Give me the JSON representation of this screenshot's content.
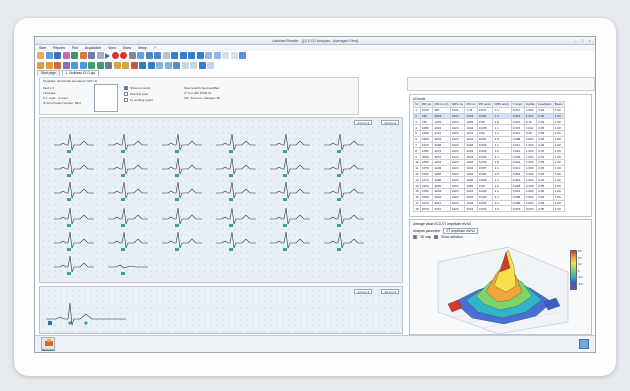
{
  "window": {
    "title": "Labchart Reader - [(1) ECG Analysis - Averaged View]"
  },
  "menu": {
    "items": [
      "Start",
      "Reports",
      "Plot",
      "Acquisition",
      "View",
      "Show",
      "Setup",
      "?"
    ]
  },
  "tabs": [
    {
      "label": "Start page"
    },
    {
      "label": "1. Multilead ECG.tgd"
    }
  ],
  "config": {
    "template": "Template: Ventricular premature (VPC 4)",
    "rows": [
      [
        "Mod",
        "1",
        "2"
      ],
      [
        "I",
        "Average"
      ],
      [
        "II",
        "1: Light · Correct"
      ],
      [
        "III",
        "Short beats Number: 89/4"
      ]
    ],
    "checks": [
      {
        "label": "Show on report",
        "checked": true
      },
      {
        "label": "Pick this beat",
        "checked": false
      },
      {
        "label": "To working report",
        "checked": false
      }
    ],
    "note": [
      "Source ECG Sources/Mac",
      "A* 2 to 24h 15/03 Int",
      "Info: Zoom 2+ changed, Alt"
    ]
  },
  "top_panel": {
    "left_menu": "24 min",
    "right_menu": "24 mm",
    "scale_left": "24 mm ▾",
    "scale_right": "24 mm ▾"
  },
  "bottom_panel": {
    "label": "24 mm ▾",
    "label2": "24 mm ▾"
  },
  "table": {
    "title": "All beats",
    "headers": [
      "Nr",
      "RR ms",
      "RR ms (A)",
      "QRS ms",
      "PR ms",
      "PR ampl.",
      "QRS ampl.",
      "T ampl.",
      "Cardio",
      "Feedback",
      "Beats"
    ],
    "rows": [
      [
        "1",
        "1070",
        "387",
        "1221",
        "1.44",
        "0.011",
        "1.1",
        "0.017",
        "1.001",
        "0.04",
        "1.00"
      ],
      [
        "2",
        "750",
        "3018",
        "1024",
        "1044",
        "0.004",
        "1.1",
        "0.014",
        "1.011",
        "0.06",
        "1.00"
      ],
      [
        "3",
        "760",
        "1270",
        "1024",
        "1033",
        "0.00",
        "1.0",
        "0.014",
        "0.10",
        "0.04",
        "1.00"
      ],
      [
        "4",
        "1080",
        "3201",
        "1024",
        "1044",
        "0.005",
        "1.1",
        "0.015",
        "1.011",
        "0.05",
        "1.00"
      ],
      [
        "5",
        "2190",
        "2211",
        "1024",
        "1031",
        "0.00",
        "1.1",
        "0.011",
        "0.10",
        "0.05",
        "1.00"
      ],
      [
        "6",
        "3100",
        "3201",
        "1024",
        "1044",
        "0.001",
        "1.0",
        "0.008",
        "1.004",
        "0.05",
        "1.00"
      ],
      [
        "7",
        "1070",
        "3200",
        "1024",
        "1022",
        "0.009",
        "1.1",
        "0.011",
        "1.004",
        "0.05",
        "1.00"
      ],
      [
        "8",
        "1080",
        "3212",
        "1024",
        "1041",
        "0.002",
        "1.0",
        "0.010",
        "1.000",
        "0.04",
        "1.00"
      ],
      [
        "9",
        "3060",
        "3270",
        "1024",
        "1043",
        "0.004",
        "1.1",
        "0.009",
        "1.002",
        "0.04",
        "1.00"
      ],
      [
        "10",
        "1060",
        "3210",
        "1024",
        "1034",
        "0.009",
        "1.0",
        "0.012",
        "1.003",
        "0.05",
        "1.00"
      ],
      [
        "11",
        "1070",
        "3220",
        "1024",
        "1044",
        "0.007",
        "1.1",
        "0.011",
        "1.004",
        "0.05",
        "1.00"
      ],
      [
        "12",
        "1060",
        "3200",
        "1024",
        "1044",
        "0.004",
        "1.0",
        "0.012",
        "1.002",
        "0.05",
        "1.00"
      ],
      [
        "13",
        "1070",
        "3180",
        "1024",
        "1040",
        "0.006",
        "1.1",
        "0.010",
        "1.001",
        "0.04",
        "1.00"
      ],
      [
        "14",
        "2120",
        "3220",
        "1024",
        "1033",
        "0.00",
        "1.0",
        "0.018",
        "0.100",
        "0.05",
        "1.00"
      ],
      [
        "15",
        "1080",
        "3204",
        "1024",
        "1024",
        "0.009",
        "1.1",
        "0.014",
        "1.003",
        "0.05",
        "1.00"
      ],
      [
        "16",
        "1060",
        "3224",
        "1024",
        "1031",
        "0.000",
        "1.1",
        "0.008",
        "1.001",
        "0.05",
        "1.00"
      ],
      [
        "17",
        "1070",
        "3211",
        "1024",
        "1044",
        "0.002",
        "1.1",
        "0.006",
        "1.004",
        "0.05",
        "1.00"
      ],
      [
        "18",
        "2070",
        "3210",
        "1024",
        "1044",
        "0.004",
        "1.0",
        "0.015",
        "0.004",
        "0.05",
        "1.00"
      ]
    ],
    "selected_row": 1
  },
  "plot": {
    "title": "Average value ECG-ST amplitude mV/s3",
    "analysis_label": "Analysis parameter",
    "analysis_value": "ST amplitude mV/s3",
    "check_3d": "3D map",
    "check_sel": "Show selection",
    "legend": [
      "0.6",
      "0.4",
      "0.2",
      "0",
      "-0.2",
      "-0.4"
    ]
  },
  "status": {
    "app_label": "Blanket/Sc..."
  },
  "colors": {
    "accent": "#1c7fd0",
    "beat_marker": "#3aa58a",
    "surface_hi": "#f6e14a"
  }
}
